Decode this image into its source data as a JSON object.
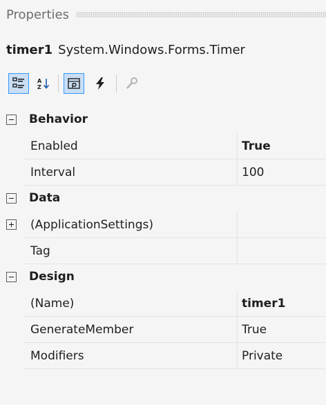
{
  "window": {
    "title": "Properties"
  },
  "selector": {
    "object_name": "timer1",
    "object_type": "System.Windows.Forms.Timer"
  },
  "toolbar": {
    "buttons": [
      {
        "icon": "categorized-icon",
        "active": true
      },
      {
        "icon": "alphabetical-icon",
        "active": false
      },
      {
        "icon": "properties-icon",
        "active": true
      },
      {
        "icon": "events-icon",
        "active": false
      },
      {
        "icon": "property-pages-icon",
        "active": false,
        "disabled": true
      }
    ]
  },
  "grid": {
    "categories": [
      {
        "label": "Behavior",
        "expanded": true,
        "properties": [
          {
            "name": "Enabled",
            "value": "True",
            "bold": true
          },
          {
            "name": "Interval",
            "value": "100",
            "bold": false
          }
        ]
      },
      {
        "label": "Data",
        "expanded": true,
        "properties": [
          {
            "name": "(ApplicationSettings)",
            "value": "",
            "bold": false,
            "expandable": true
          },
          {
            "name": "Tag",
            "value": "",
            "bold": false
          }
        ]
      },
      {
        "label": "Design",
        "expanded": true,
        "properties": [
          {
            "name": "(Name)",
            "value": "timer1",
            "bold": true
          },
          {
            "name": "GenerateMember",
            "value": "True",
            "bold": false
          },
          {
            "name": "Modifiers",
            "value": "Private",
            "bold": false
          }
        ]
      }
    ]
  },
  "colors": {
    "background": "#f5f5f5",
    "active_button": "#c9def5",
    "active_border": "#3399ff",
    "grid_line": "#e3e3e3",
    "events_icon": "#1e1e1e"
  }
}
